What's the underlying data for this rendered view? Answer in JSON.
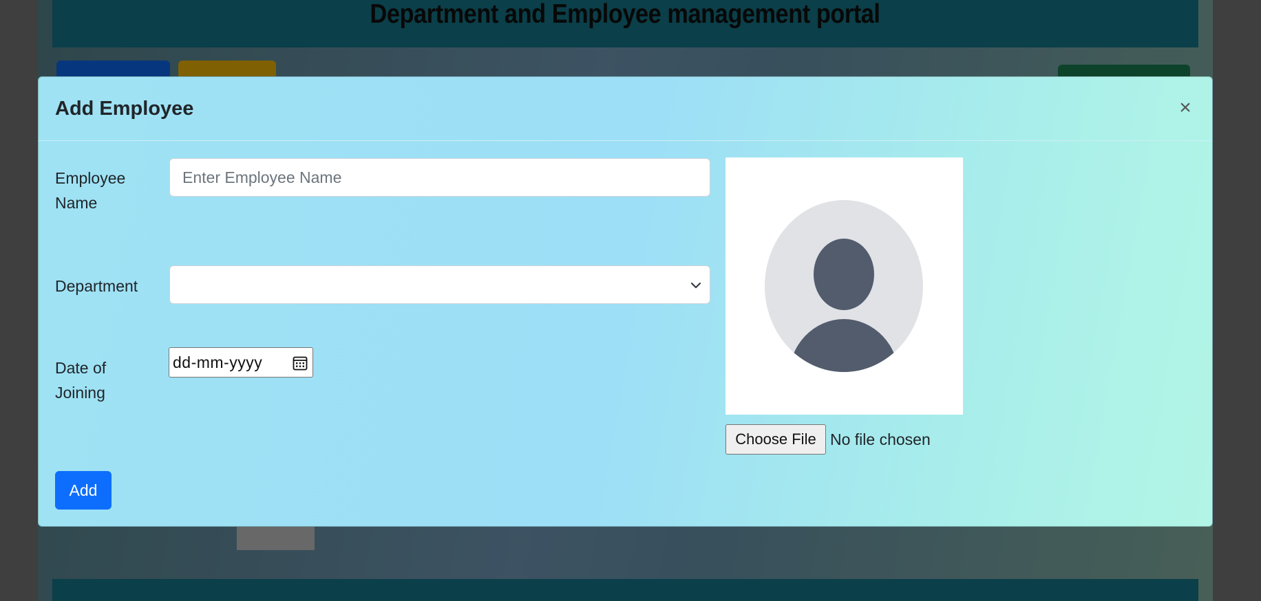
{
  "background_page": {
    "title": "Department and Employee management portal",
    "buttons": {
      "departments_label": "",
      "employees_label": "",
      "add_label": ""
    }
  },
  "modal": {
    "title": "Add Employee",
    "close_glyph": "×",
    "fields": {
      "employee_name": {
        "label": "Employee Name",
        "placeholder": "Enter Employee Name",
        "value": ""
      },
      "department": {
        "label": "Department",
        "selected": ""
      },
      "date_of_joining": {
        "label": "Date of Joining",
        "value": "dd-mm-yyyy"
      }
    },
    "photo": {
      "icon": "user-avatar-placeholder",
      "choose_file_label": "Choose File",
      "file_status": "No file chosen"
    },
    "submit_label": "Add"
  },
  "colors": {
    "header": "#167f93",
    "primary": "#0d6efd",
    "warning": "#ffc107",
    "success": "#198754",
    "avatar_bg": "#e0e2e6",
    "avatar_fg": "#525c6d"
  }
}
